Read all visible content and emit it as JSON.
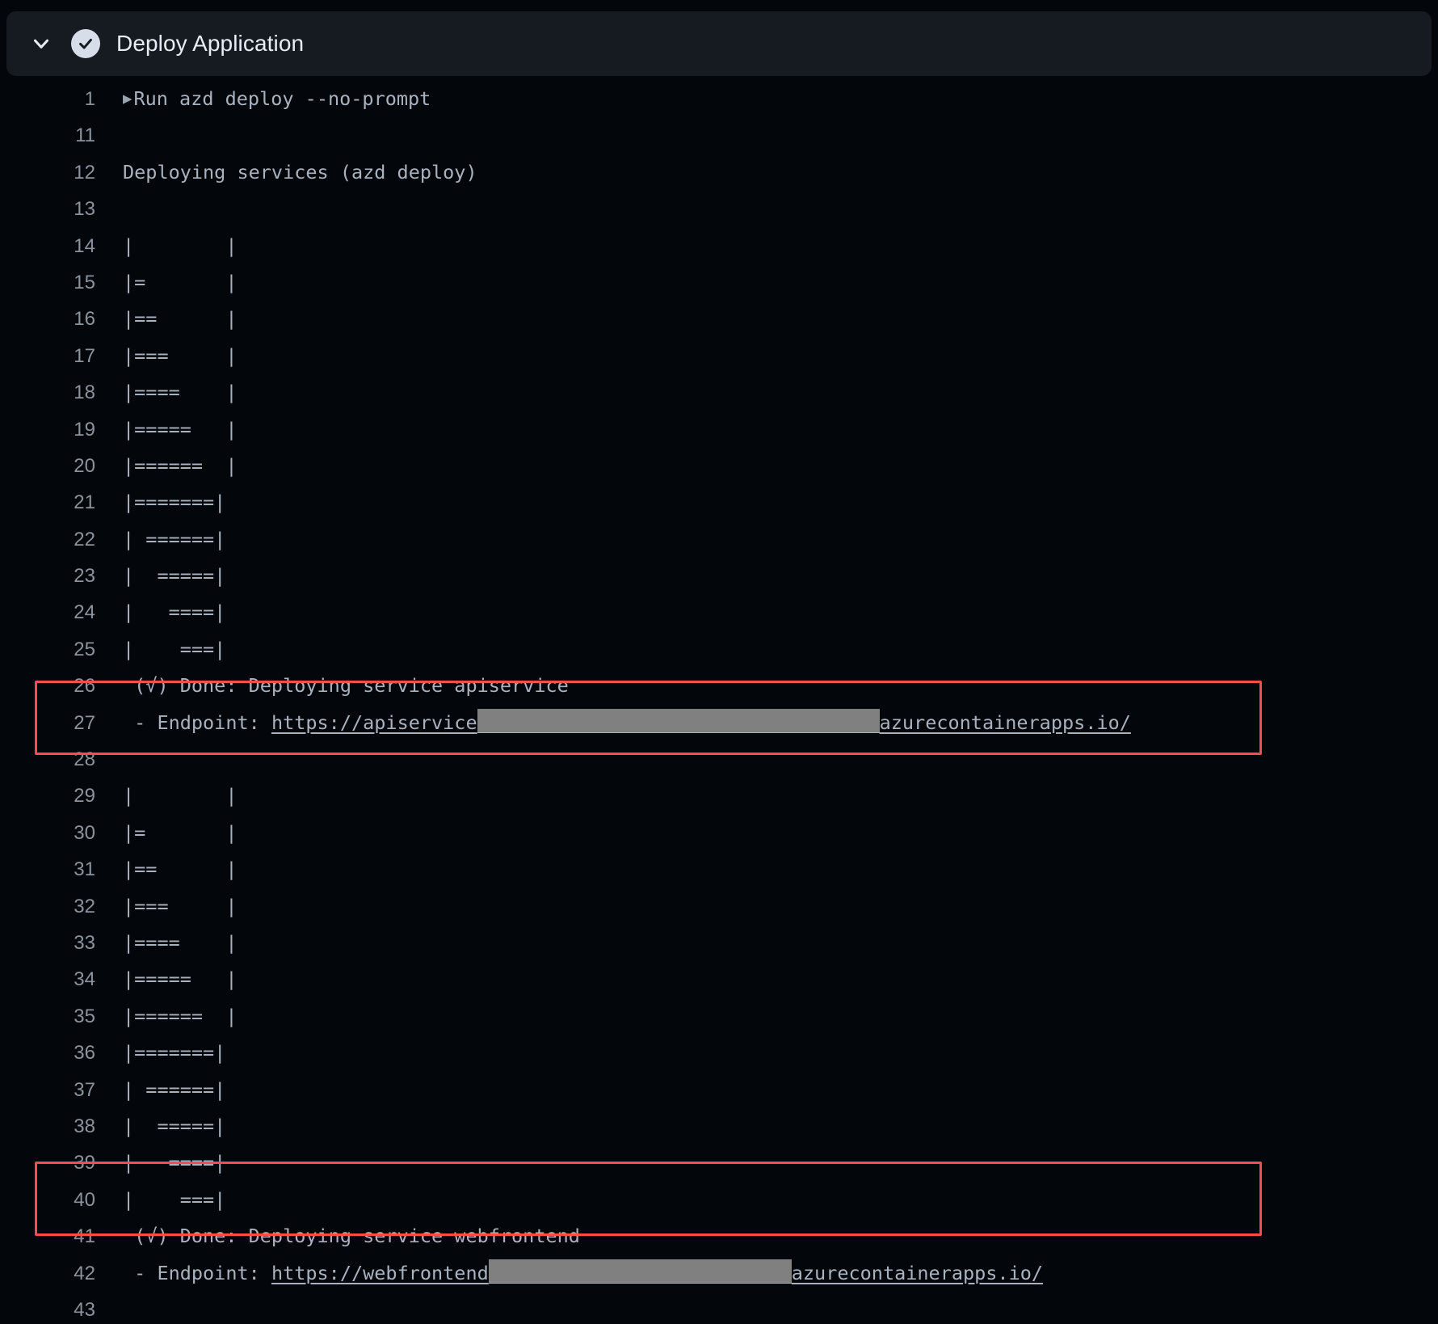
{
  "header": {
    "title": "Deploy Application",
    "chevron_icon": "chevron-down-icon",
    "status_icon": "check-circle-icon",
    "expanded": true
  },
  "colors": {
    "page_background": "#03060a",
    "header_background": "#161a21",
    "text": "#a9b3c0",
    "line_number": "#8b949e",
    "highlight_border": "#fb4c4c",
    "redaction": "#808080",
    "status_badge": "#d8dee9"
  },
  "log": {
    "lines": [
      {
        "n": "1",
        "icon": "play-triangle-icon",
        "text": "Run azd deploy --no-prompt"
      },
      {
        "n": "11",
        "text": ""
      },
      {
        "n": "12",
        "text": "Deploying services (azd deploy)"
      },
      {
        "n": "13",
        "text": ""
      },
      {
        "n": "14",
        "text": "|        |"
      },
      {
        "n": "15",
        "text": "|=       |"
      },
      {
        "n": "16",
        "text": "|==      |"
      },
      {
        "n": "17",
        "text": "|===     |"
      },
      {
        "n": "18",
        "text": "|====    |"
      },
      {
        "n": "19",
        "text": "|=====   |"
      },
      {
        "n": "20",
        "text": "|======  |"
      },
      {
        "n": "21",
        "text": "|=======|"
      },
      {
        "n": "22",
        "text": "| ======|"
      },
      {
        "n": "23",
        "text": "|  =====|"
      },
      {
        "n": "24",
        "text": "|   ====|"
      },
      {
        "n": "25",
        "text": "|    ===|"
      },
      {
        "n": "26",
        "text": " (√) Done: Deploying service apiservice",
        "highlighted": true
      },
      {
        "n": "27",
        "text": " - Endpoint: ",
        "highlighted": true,
        "link_prefix": "https://apiservice",
        "redacted": true,
        "redact_width": 498,
        "link_suffix": "azurecontainerapps.io/"
      },
      {
        "n": "28",
        "text": ""
      },
      {
        "n": "29",
        "text": "|        |"
      },
      {
        "n": "30",
        "text": "|=       |"
      },
      {
        "n": "31",
        "text": "|==      |"
      },
      {
        "n": "32",
        "text": "|===     |"
      },
      {
        "n": "33",
        "text": "|====    |"
      },
      {
        "n": "34",
        "text": "|=====   |"
      },
      {
        "n": "35",
        "text": "|======  |"
      },
      {
        "n": "36",
        "text": "|=======|"
      },
      {
        "n": "37",
        "text": "| ======|"
      },
      {
        "n": "38",
        "text": "|  =====|"
      },
      {
        "n": "39",
        "text": "|   ====|"
      },
      {
        "n": "40",
        "text": "|    ===|"
      },
      {
        "n": "41",
        "text": " (√) Done: Deploying service webfrontend",
        "highlighted": true
      },
      {
        "n": "42",
        "text": " - Endpoint: ",
        "highlighted": true,
        "link_prefix": "https://webfrontend",
        "redacted": true,
        "redact_width": 375,
        "link_suffix": "azurecontainerapps.io/"
      },
      {
        "n": "43",
        "text": ""
      }
    ]
  },
  "highlights": [
    {
      "name": "apiservice-endpoint-highlight",
      "from_line": "26",
      "to_line": "27"
    },
    {
      "name": "webfrontend-endpoint-highlight",
      "from_line": "41",
      "to_line": "42"
    }
  ]
}
